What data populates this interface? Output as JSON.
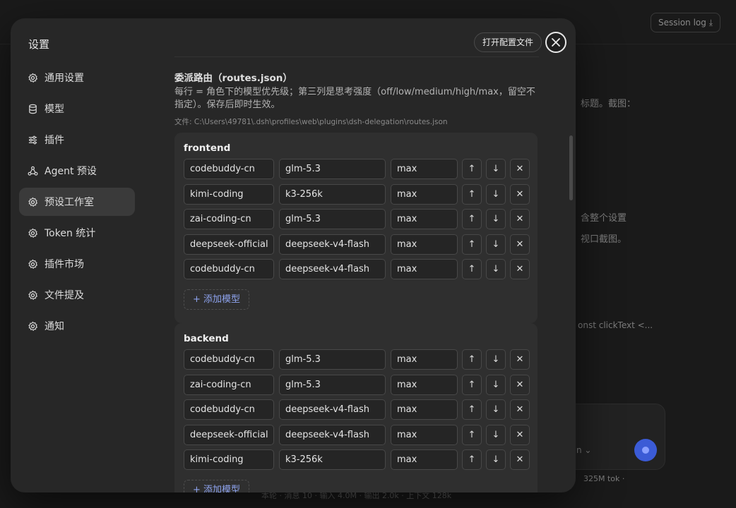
{
  "background": {
    "session_log": "Session log ⤓",
    "fragments": [
      "标题。截图：",
      "含整个设置",
      "视口截图。",
      "onst clickText <...",
      "n ⌄",
      "325M tok ·",
      "本轮 · 消息 10 · 输入 4.0M · 输出 2.0k · 上下文 128k"
    ]
  },
  "sidebar": {
    "title": "设置",
    "items": [
      {
        "label": "通用设置",
        "icon": "gear-icon",
        "active": false
      },
      {
        "label": "模型",
        "icon": "database-icon",
        "active": false
      },
      {
        "label": "插件",
        "icon": "sliders-icon",
        "active": false
      },
      {
        "label": "Agent 预设",
        "icon": "agent-icon",
        "active": false
      },
      {
        "label": "预设工作室",
        "icon": "gear-icon",
        "active": true
      },
      {
        "label": "Token 统计",
        "icon": "gear-icon",
        "active": false
      },
      {
        "label": "插件市场",
        "icon": "gear-icon",
        "active": false
      },
      {
        "label": "文件提及",
        "icon": "gear-icon",
        "active": false
      },
      {
        "label": "通知",
        "icon": "gear-icon",
        "active": false
      }
    ]
  },
  "header": {
    "open_config_label": "打开配置文件",
    "close_icon": "close-icon"
  },
  "routes": {
    "title": "委派路由（routes.json）",
    "description": "每行 = 角色下的模型优先级；第三列是思考强度（off/low/medium/high/max，留空不指定）。保存后即时生效。",
    "file_path": "文件: C:\\Users\\49781\\.dsh\\profiles\\web\\plugins\\dsh-delegation\\routes.json",
    "add_model_label": "+ 添加模型",
    "icons": {
      "up": "↑",
      "down": "↓",
      "delete": "✕"
    },
    "roles": [
      {
        "name": "frontend",
        "rows": [
          {
            "provider": "codebuddy-cn",
            "model": "glm-5.3",
            "effort": "max"
          },
          {
            "provider": "kimi-coding",
            "model": "k3-256k",
            "effort": "max"
          },
          {
            "provider": "zai-coding-cn",
            "model": "glm-5.3",
            "effort": "max"
          },
          {
            "provider": "deepseek-official",
            "model": "deepseek-v4-flash",
            "effort": "max"
          },
          {
            "provider": "codebuddy-cn",
            "model": "deepseek-v4-flash",
            "effort": "max"
          }
        ]
      },
      {
        "name": "backend",
        "rows": [
          {
            "provider": "codebuddy-cn",
            "model": "glm-5.3",
            "effort": "max"
          },
          {
            "provider": "zai-coding-cn",
            "model": "glm-5.3",
            "effort": "max"
          },
          {
            "provider": "codebuddy-cn",
            "model": "deepseek-v4-flash",
            "effort": "max"
          },
          {
            "provider": "deepseek-official",
            "model": "deepseek-v4-flash",
            "effort": "max"
          },
          {
            "provider": "kimi-coding",
            "model": "k3-256k",
            "effort": "max"
          }
        ]
      }
    ]
  }
}
